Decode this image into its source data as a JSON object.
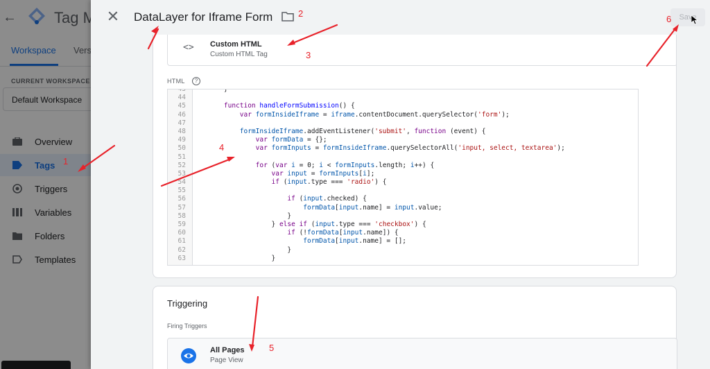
{
  "background_app": {
    "app_name": "Tag Ma",
    "back_arrow": "←",
    "tabs": [
      {
        "label": "Workspace"
      },
      {
        "label": "Vers"
      }
    ],
    "current_workspace_label": "CURRENT WORKSPACE",
    "workspace_name": "Default Workspace",
    "nav_items": [
      {
        "label": "Overview",
        "icon": "briefcase-icon"
      },
      {
        "label": "Tags",
        "icon": "tag-icon",
        "active": true
      },
      {
        "label": "Triggers",
        "icon": "trigger-icon"
      },
      {
        "label": "Variables",
        "icon": "variables-icon"
      },
      {
        "label": "Folders",
        "icon": "folder-icon"
      },
      {
        "label": "Templates",
        "icon": "template-icon"
      }
    ]
  },
  "sheet": {
    "close_glyph": "✕",
    "title": "DataLayer for Iframe Form",
    "save_label": "Save",
    "tag_type": {
      "icon_text": "<>",
      "name": "Custom HTML",
      "subtitle": "Custom HTML Tag"
    },
    "html_label": "HTML",
    "help_glyph": "?",
    "code": {
      "first_line_number": 43,
      "lines": [
        "    }",
        "",
        "    function handleFormSubmission() {",
        "        var formInsideIframe = iframe.contentDocument.querySelector('form');",
        "",
        "        formInsideIframe.addEventListener('submit', function (event) {",
        "            var formData = {};",
        "            var formInputs = formInsideIframe.querySelectorAll('input, select, textarea');",
        "",
        "            for (var i = 0; i < formInputs.length; i++) {",
        "                var input = formInputs[i];",
        "                if (input.type === 'radio') {",
        "",
        "                    if (input.checked) {",
        "                        formData[input.name] = input.value;",
        "                    }",
        "                } else if (input.type === 'checkbox') {",
        "                    if (!formData[input.name]) {",
        "                        formData[input.name] = [];",
        "                    }",
        "                }"
      ]
    },
    "triggering": {
      "title": "Triggering",
      "firing_label": "Firing Triggers",
      "trigger": {
        "name": "All Pages",
        "subtitle": "Page View",
        "icon": "eye-icon"
      }
    }
  },
  "annotations": {
    "color": "#e8222a",
    "numbers": [
      "1",
      "2",
      "3",
      "4",
      "5",
      "6"
    ]
  },
  "colors": {
    "accent": "#1a73e8",
    "annotation_red": "#e8222a",
    "trigger_icon_blue": "#1a73e8"
  }
}
